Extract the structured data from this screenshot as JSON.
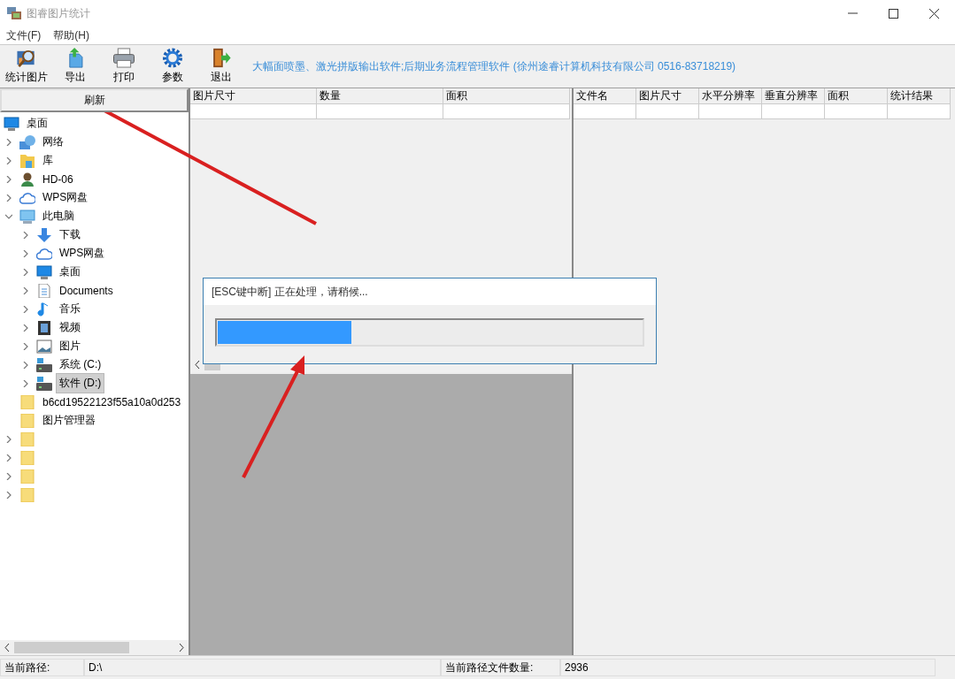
{
  "window": {
    "title": "图睿图片统计"
  },
  "menu": [
    "文件(F)",
    "帮助(H)"
  ],
  "toolbar": [
    {
      "label": "统计图片",
      "kind": "stats"
    },
    {
      "label": "导出",
      "kind": "export"
    },
    {
      "label": "打印",
      "kind": "print"
    },
    {
      "label": "参数",
      "kind": "settings"
    },
    {
      "label": "退出",
      "kind": "exit"
    }
  ],
  "banner": "大幅面喷墨、激光拼版输出软件;后期业务流程管理软件 (徐州途睿计算机科技有限公司 0516-83718219)",
  "refresh_button": "刷新",
  "tree": [
    {
      "label": "桌面",
      "kind": "desktop",
      "expander": false,
      "selected": false,
      "children": [
        {
          "label": "网络",
          "kind": "network",
          "expander": true,
          "expanded": false,
          "selected": false
        },
        {
          "label": "库",
          "kind": "library",
          "expander": true,
          "expanded": false,
          "selected": false
        },
        {
          "label": "HD-06",
          "kind": "user",
          "expander": true,
          "expanded": false,
          "selected": false
        },
        {
          "label": "WPS网盘",
          "kind": "cloud",
          "expander": true,
          "expanded": false,
          "selected": false
        },
        {
          "label": "此电脑",
          "kind": "pc",
          "expander": true,
          "expanded": true,
          "selected": false,
          "children": [
            {
              "label": "下载",
              "kind": "download",
              "expander": true,
              "expanded": false,
              "selected": false
            },
            {
              "label": "WPS网盘",
              "kind": "cloud",
              "expander": true,
              "expanded": false,
              "selected": false
            },
            {
              "label": "桌面",
              "kind": "desktop",
              "expander": true,
              "expanded": false,
              "selected": false
            },
            {
              "label": "Documents",
              "kind": "doc",
              "expander": true,
              "expanded": false,
              "selected": false
            },
            {
              "label": "音乐",
              "kind": "music",
              "expander": true,
              "expanded": false,
              "selected": false
            },
            {
              "label": "视频",
              "kind": "video",
              "expander": true,
              "expanded": false,
              "selected": false
            },
            {
              "label": "图片",
              "kind": "picture",
              "expander": true,
              "expanded": false,
              "selected": false
            },
            {
              "label": "系统 (C:)",
              "kind": "drive",
              "expander": true,
              "expanded": false,
              "selected": false
            },
            {
              "label": "软件 (D:)",
              "kind": "drive",
              "expander": true,
              "expanded": false,
              "selected": true
            }
          ]
        },
        {
          "label": "b6cd19522123f55a10a0d253",
          "kind": "folder",
          "expander": false,
          "selected": false
        },
        {
          "label": "图片管理器",
          "kind": "folder",
          "expander": false,
          "selected": false
        },
        {
          "kind": "folder",
          "expander": true,
          "expanded": false,
          "selected": false
        },
        {
          "kind": "folder",
          "expander": true,
          "expanded": false,
          "selected": false
        },
        {
          "kind": "folder",
          "expander": true,
          "expanded": false,
          "selected": false
        },
        {
          "kind": "folder",
          "expander": true,
          "expanded": false,
          "selected": false
        }
      ]
    }
  ],
  "summary_table": {
    "columns": [
      "图片尺寸",
      "数量",
      "面积"
    ]
  },
  "file_table": {
    "columns": [
      "文件名",
      "图片尺寸",
      "水平分辨率",
      "垂直分辨率",
      "面积",
      "统计结果"
    ]
  },
  "progress_dialog": {
    "message": "[ESC键中断] 正在处理，请稍候...",
    "level": 0.315
  },
  "status_bar": [
    {
      "label": "当前路径:",
      "value": "D:\\"
    },
    {
      "label": "当前路径文件数量:",
      "value": "2936"
    }
  ]
}
